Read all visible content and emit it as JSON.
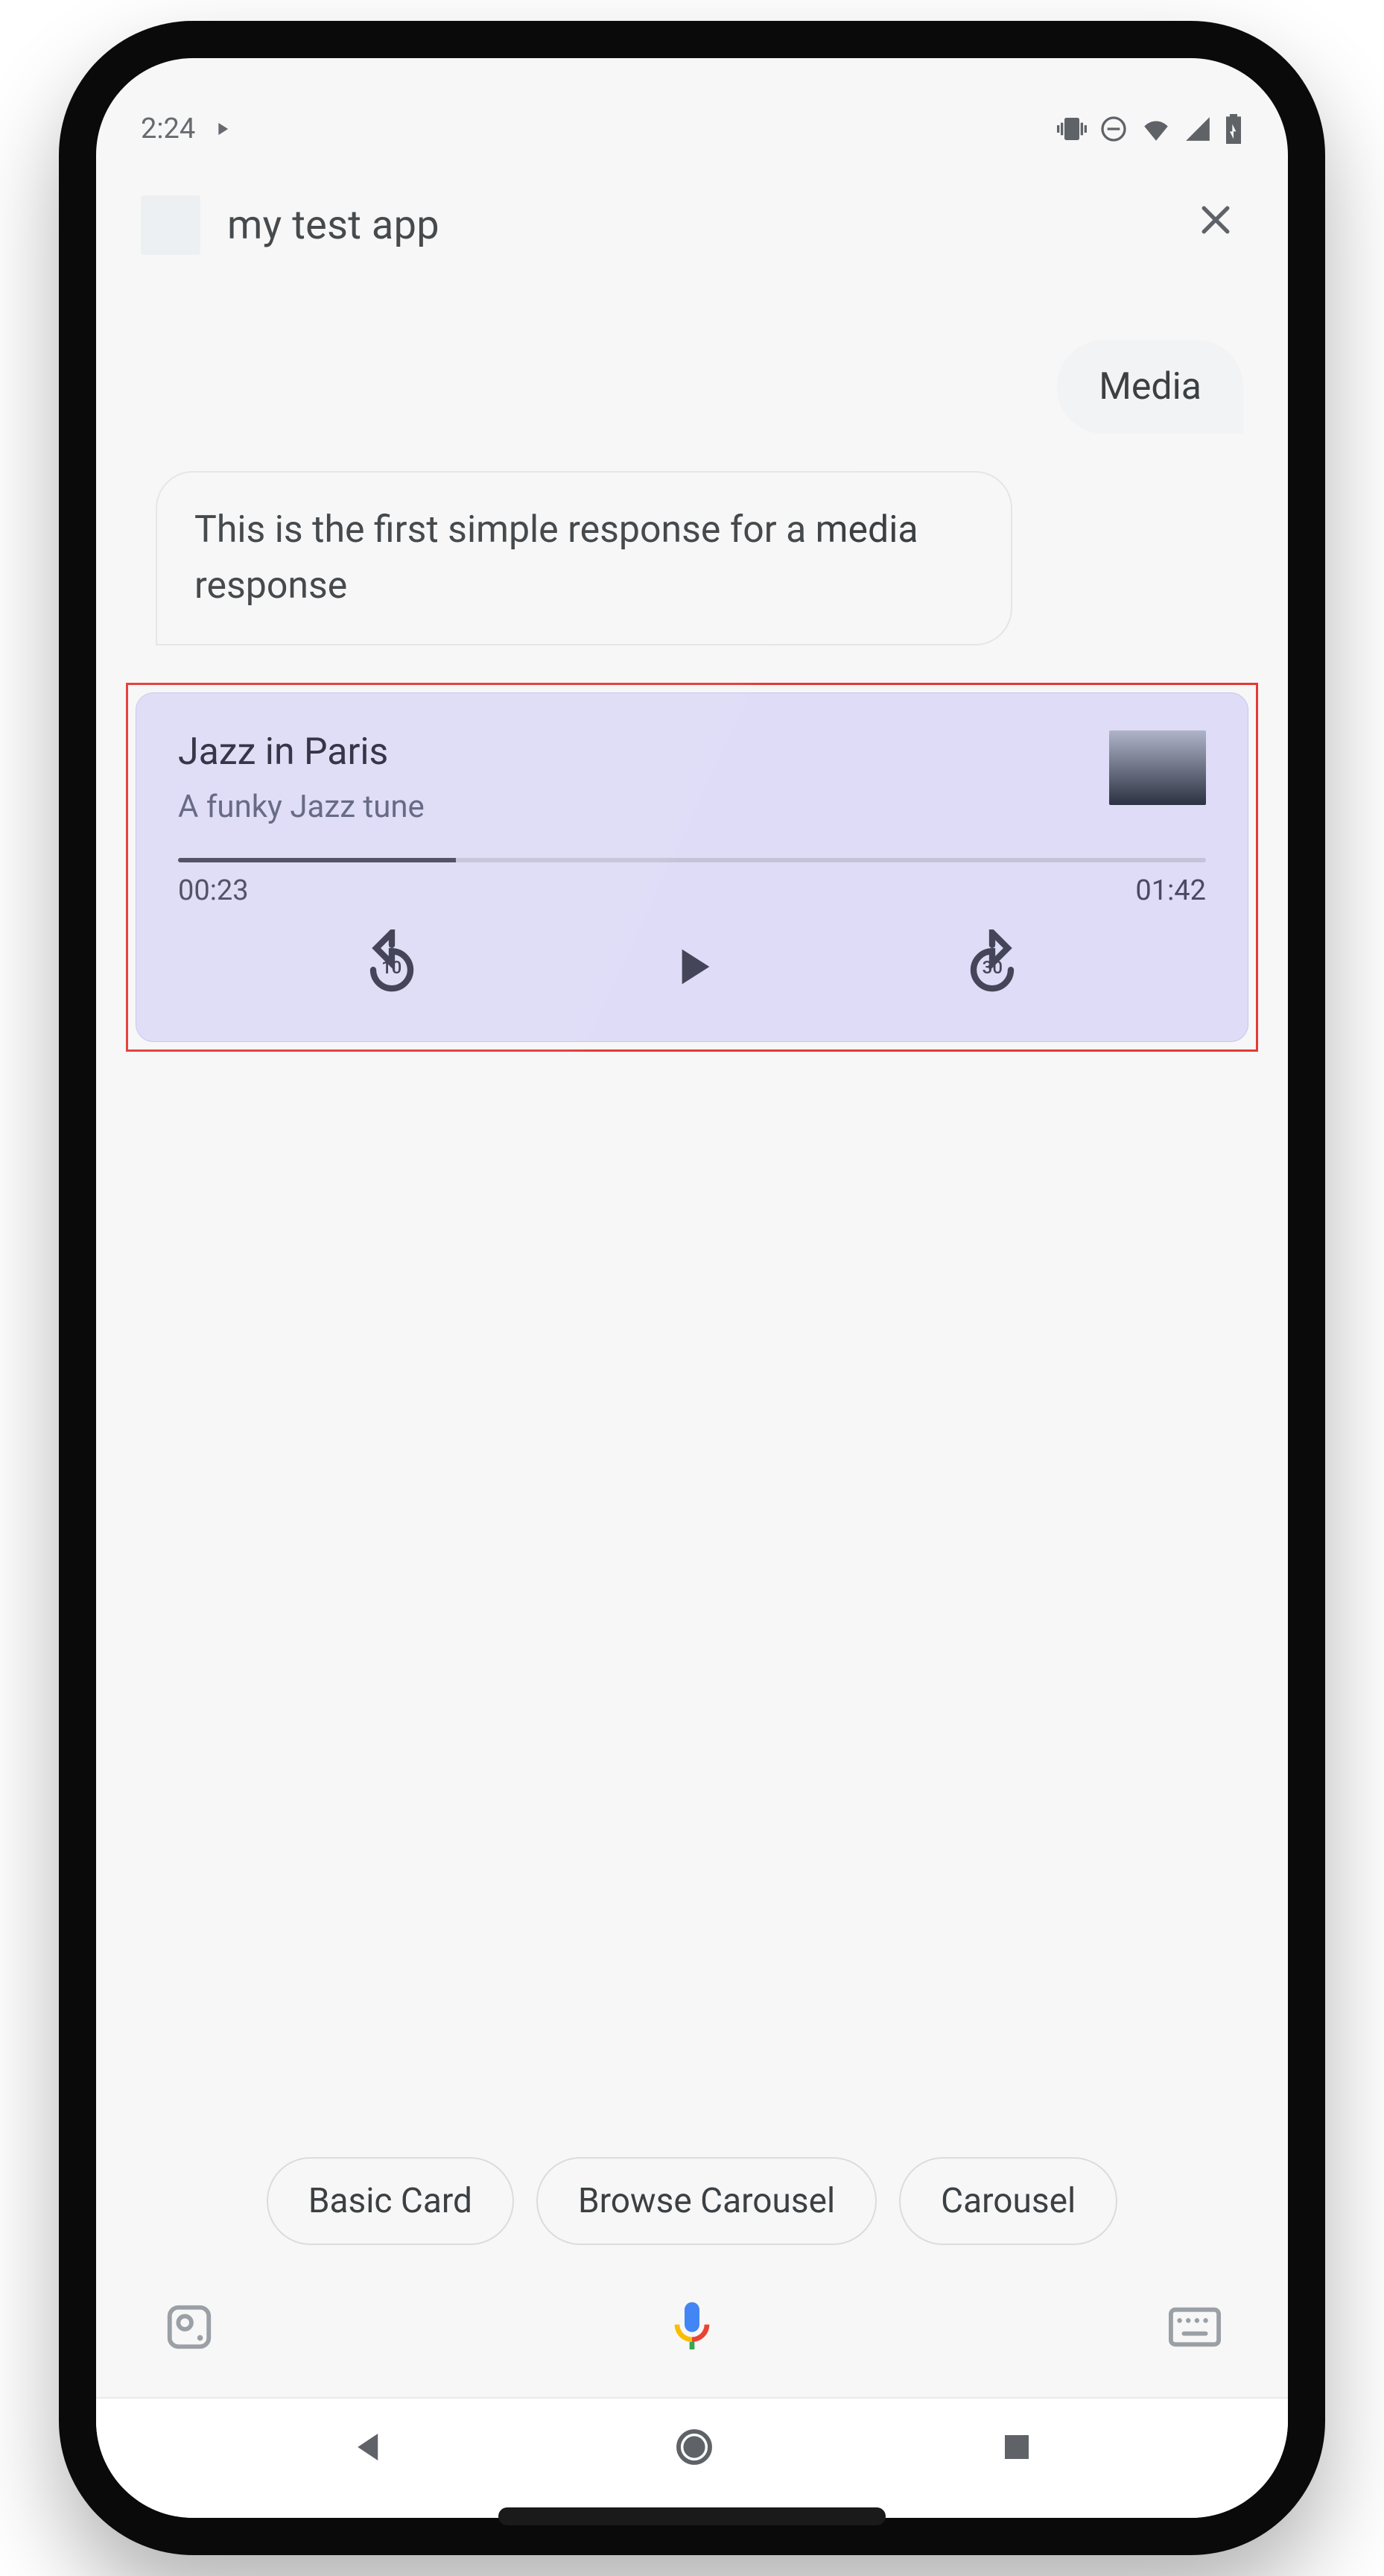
{
  "status": {
    "time": "2:24"
  },
  "header": {
    "app_title": "my test app"
  },
  "conversation": {
    "user_message": "Media",
    "assistant_message": "This is the first simple response for a media response"
  },
  "media": {
    "title": "Jazz in Paris",
    "subtitle": "A funky Jazz tune",
    "elapsed": "00:23",
    "duration": "01:42",
    "rewind_seconds": "10",
    "forward_seconds": "30",
    "progress_percent": 27
  },
  "chips": {
    "basic_card": "Basic Card",
    "browse_carousel": "Browse Carousel",
    "carousel": "Carousel"
  }
}
